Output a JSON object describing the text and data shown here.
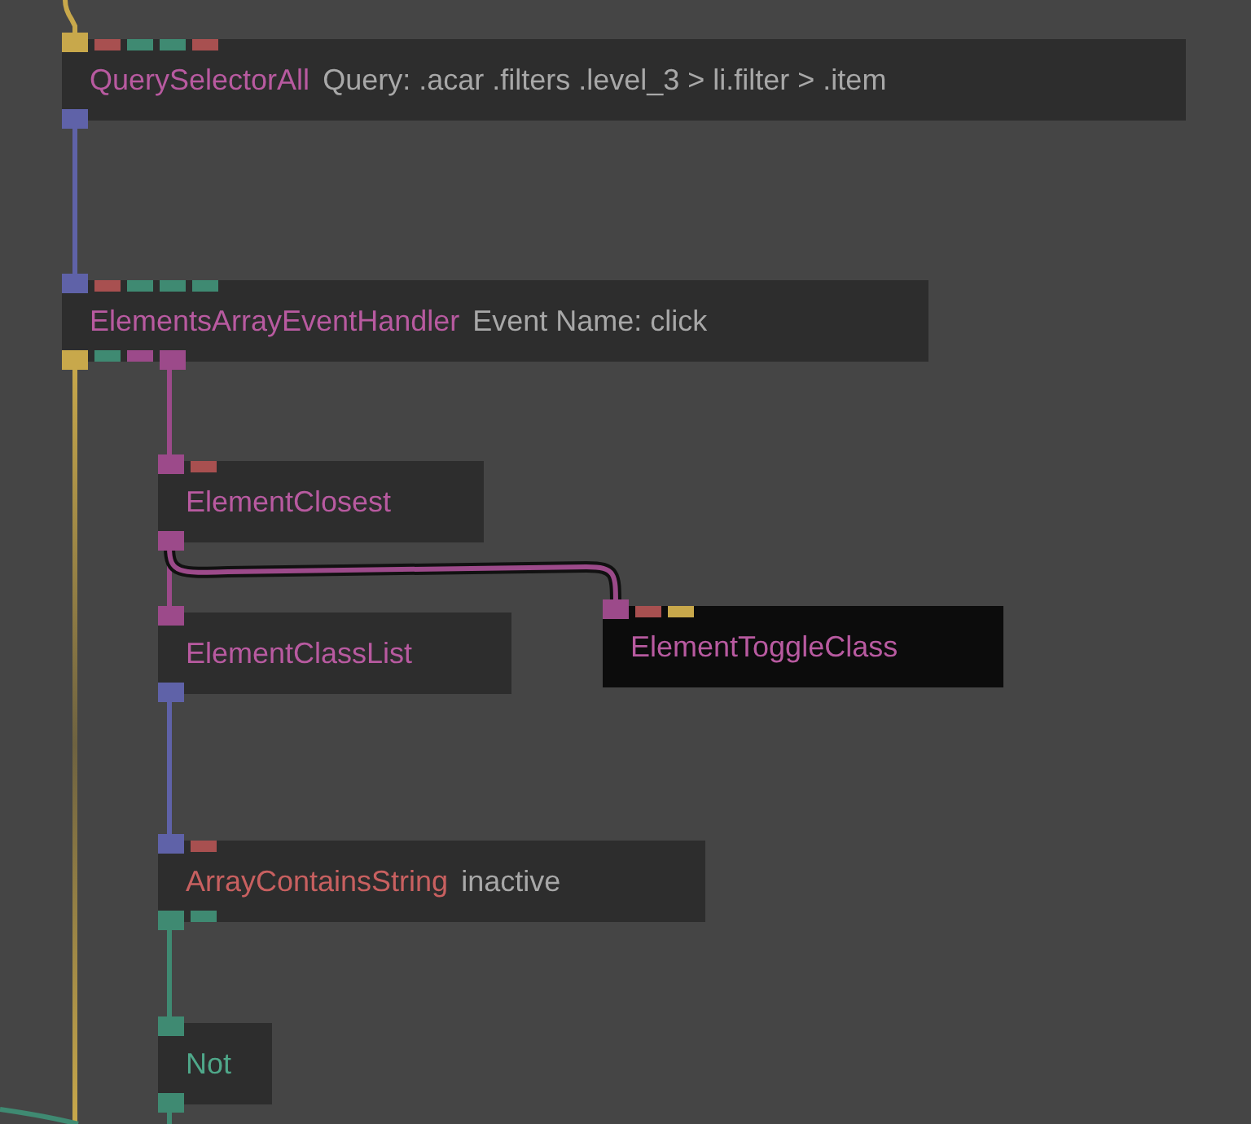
{
  "nodes": [
    {
      "title": "QuerySelectorAll",
      "color": "#b85aa0",
      "parameter": "Query: .acar .filters .level_3 > li.filter > .item",
      "selected": false,
      "inputs": [
        {
          "color": "#c8a84b",
          "connected": true
        },
        {
          "color": "#a85050",
          "connected": false
        },
        {
          "color": "#3f8a72",
          "connected": false
        },
        {
          "color": "#3f8a72",
          "connected": false
        },
        {
          "color": "#a85050",
          "connected": false
        }
      ],
      "outputs": [
        {
          "color": "#5f62a8",
          "connected": true
        }
      ]
    },
    {
      "title": "ElementsArrayEventHandler",
      "color": "#b85aa0",
      "parameter": "Event Name: click",
      "selected": false,
      "inputs": [
        {
          "color": "#5f62a8",
          "connected": true
        },
        {
          "color": "#a85050",
          "connected": false
        },
        {
          "color": "#3f8a72",
          "connected": false
        },
        {
          "color": "#3f8a72",
          "connected": false
        },
        {
          "color": "#3f8a72",
          "connected": false
        }
      ],
      "outputs": [
        {
          "color": "#c8a84b",
          "connected": true
        },
        {
          "color": "#3f8a72",
          "connected": false
        },
        {
          "color": "#9c4a8a",
          "connected": false
        },
        {
          "color": "#9c4a8a",
          "connected": true
        }
      ]
    },
    {
      "title": "ElementClosest",
      "color": "#b85aa0",
      "selected": false,
      "inputs": [
        {
          "color": "#9c4a8a",
          "connected": true
        },
        {
          "color": "#a85050",
          "connected": false
        }
      ],
      "outputs": [
        {
          "color": "#9c4a8a",
          "connected": true
        }
      ]
    },
    {
      "title": "ElementClassList",
      "color": "#b85aa0",
      "selected": false,
      "inputs": [
        {
          "color": "#9c4a8a",
          "connected": true
        }
      ],
      "outputs": [
        {
          "color": "#5f62a8",
          "connected": true
        }
      ]
    },
    {
      "title": "ElementToggleClass",
      "color": "#b85aa0",
      "selected": true,
      "inputs": [
        {
          "color": "#9c4a8a",
          "connected": true
        },
        {
          "color": "#a85050",
          "connected": false
        },
        {
          "color": "#c8a84b",
          "connected": false
        }
      ]
    },
    {
      "title": "ArrayContainsString",
      "color": "#c86060",
      "parameter": "inactive",
      "selected": false,
      "inputs": [
        {
          "color": "#5f62a8",
          "connected": true
        },
        {
          "color": "#a85050",
          "connected": false
        }
      ],
      "outputs": [
        {
          "color": "#3f8a72",
          "connected": true
        },
        {
          "color": "#3f8a72",
          "connected": false
        }
      ]
    },
    {
      "title": "Not",
      "color": "#4fa88a",
      "selected": false,
      "inputs": [
        {
          "color": "#3f8a72",
          "connected": true
        }
      ],
      "outputs": [
        {
          "color": "#3f8a72",
          "connected": true
        }
      ]
    }
  ]
}
